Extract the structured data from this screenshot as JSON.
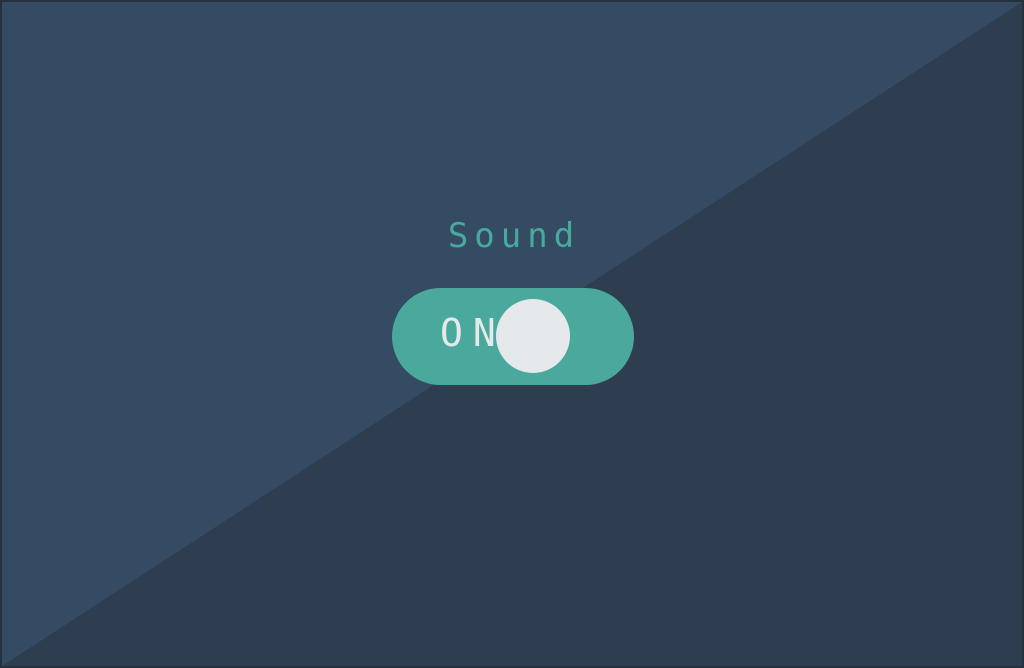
{
  "settings": {
    "label": "Sound",
    "toggle": {
      "state_text": "ON",
      "checked": true
    }
  },
  "colors": {
    "background_dark": "#2e3d50",
    "background_light": "#354b63",
    "accent": "#4aa99c",
    "knob": "#e6e9ec"
  }
}
